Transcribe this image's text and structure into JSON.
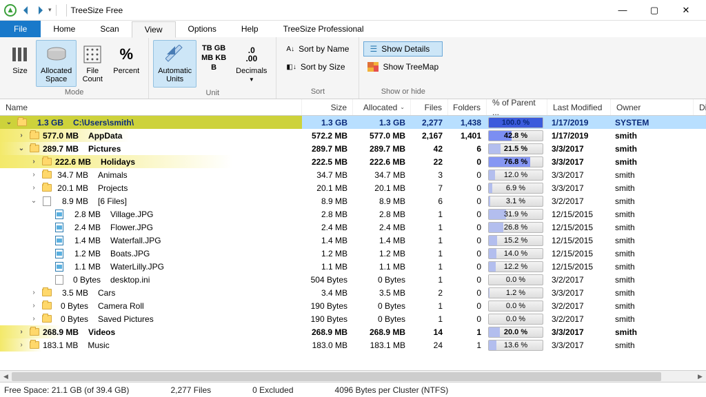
{
  "app": {
    "title": "TreeSize Free"
  },
  "win": {
    "min": "—",
    "max": "▢",
    "close": "✕"
  },
  "tabs": {
    "file": "File",
    "home": "Home",
    "scan": "Scan",
    "view": "View",
    "options": "Options",
    "help": "Help",
    "pro": "TreeSize Professional"
  },
  "ribbon": {
    "mode": {
      "label": "Mode",
      "size": "Size",
      "allocated": "Allocated\nSpace",
      "filecount": "File\nCount",
      "percent": "Percent"
    },
    "unit": {
      "label": "Unit",
      "auto": "Automatic\nUnits",
      "tb": "TB",
      "gb": "GB",
      "mb": "MB",
      "kb": "KB",
      "b": "B",
      "decimals": "Decimals",
      "decimals_val": ".00"
    },
    "sort": {
      "label": "Sort",
      "byname": "Sort by Name",
      "bysize": "Sort by Size"
    },
    "showhide": {
      "label": "Show or hide",
      "details": "Show Details",
      "treemap": "Show TreeMap"
    }
  },
  "columns": {
    "name": "Name",
    "size": "Size",
    "alloc": "Allocated",
    "files": "Files",
    "folders": "Folders",
    "pct": "% of Parent ...",
    "mod": "Last Modified",
    "owner": "Owner",
    "ext": "Di"
  },
  "rows": [
    {
      "indent": 0,
      "exp": "open",
      "icon": "folder",
      "sizetxt": "1.3 GB",
      "name": "C:\\Users\\smith\\",
      "size": "1.3 GB",
      "alloc": "1.3 GB",
      "files": "2,277",
      "folders": "1,438",
      "pct": 100.0,
      "pctlbl": "100.0 %",
      "pcol": "#3b5bdc",
      "mod": "1/17/2019",
      "own": "SYSTEM",
      "bold": true,
      "root": true,
      "grad": 100,
      "gcol": "#cdd23b"
    },
    {
      "indent": 1,
      "exp": "closed",
      "icon": "folder",
      "sizetxt": "577.0 MB",
      "name": "AppData",
      "size": "572.2 MB",
      "alloc": "577.0 MB",
      "files": "2,167",
      "folders": "1,401",
      "pct": 42.8,
      "pctlbl": "42.8 %",
      "pcol": "#7b8ef2",
      "mod": "1/17/2019",
      "own": "smith",
      "bold": true,
      "grad": 43,
      "gcol": "#f3e96a"
    },
    {
      "indent": 1,
      "exp": "open",
      "icon": "folder",
      "sizetxt": "289.7 MB",
      "name": "Pictures",
      "size": "289.7 MB",
      "alloc": "289.7 MB",
      "files": "42",
      "folders": "6",
      "pct": 21.5,
      "pctlbl": "21.5 %",
      "pcol": "#b3beee",
      "mod": "3/3/2017",
      "own": "smith",
      "bold": true,
      "grad": 22,
      "gcol": "#f3e96a"
    },
    {
      "indent": 2,
      "exp": "closed",
      "icon": "folder",
      "sizetxt": "222.6 MB",
      "name": "Holidays",
      "size": "222.5 MB",
      "alloc": "222.6 MB",
      "files": "22",
      "folders": "0",
      "pct": 76.8,
      "pctlbl": "76.8 %",
      "pcol": "#8697f3",
      "mod": "3/3/2017",
      "own": "smith",
      "bold": true,
      "grad": 77,
      "gcol": "#f3e96a"
    },
    {
      "indent": 2,
      "exp": "closed",
      "icon": "folder",
      "sizetxt": "34.7 MB",
      "name": "Animals",
      "size": "34.7 MB",
      "alloc": "34.7 MB",
      "files": "3",
      "folders": "0",
      "pct": 12.0,
      "pctlbl": "12.0 %",
      "pcol": "#b3beee",
      "mod": "3/3/2017",
      "own": "smith"
    },
    {
      "indent": 2,
      "exp": "closed",
      "icon": "folder",
      "sizetxt": "20.1 MB",
      "name": "Projects",
      "size": "20.1 MB",
      "alloc": "20.1 MB",
      "files": "7",
      "folders": "0",
      "pct": 6.9,
      "pctlbl": "6.9 %",
      "pcol": "#b3beee",
      "mod": "3/3/2017",
      "own": "smith"
    },
    {
      "indent": 2,
      "exp": "open",
      "icon": "file",
      "sizetxt": "8.9 MB",
      "name": "[6 Files]",
      "size": "8.9 MB",
      "alloc": "8.9 MB",
      "files": "6",
      "folders": "0",
      "pct": 3.1,
      "pctlbl": "3.1 %",
      "pcol": "#b3beee",
      "mod": "3/2/2017",
      "own": "smith"
    },
    {
      "indent": 3,
      "exp": "none",
      "icon": "jpg",
      "sizetxt": "2.8 MB",
      "name": "Village.JPG",
      "size": "2.8 MB",
      "alloc": "2.8 MB",
      "files": "1",
      "folders": "0",
      "pct": 31.9,
      "pctlbl": "31.9 %",
      "pcol": "#b3beee",
      "mod": "12/15/2015",
      "own": "smith"
    },
    {
      "indent": 3,
      "exp": "none",
      "icon": "jpg",
      "sizetxt": "2.4 MB",
      "name": "Flower.JPG",
      "size": "2.4 MB",
      "alloc": "2.4 MB",
      "files": "1",
      "folders": "0",
      "pct": 26.8,
      "pctlbl": "26.8 %",
      "pcol": "#b3beee",
      "mod": "12/15/2015",
      "own": "smith"
    },
    {
      "indent": 3,
      "exp": "none",
      "icon": "jpg",
      "sizetxt": "1.4 MB",
      "name": "Waterfall.JPG",
      "size": "1.4 MB",
      "alloc": "1.4 MB",
      "files": "1",
      "folders": "0",
      "pct": 15.2,
      "pctlbl": "15.2 %",
      "pcol": "#b3beee",
      "mod": "12/15/2015",
      "own": "smith"
    },
    {
      "indent": 3,
      "exp": "none",
      "icon": "jpg",
      "sizetxt": "1.2 MB",
      "name": "Boats.JPG",
      "size": "1.2 MB",
      "alloc": "1.2 MB",
      "files": "1",
      "folders": "0",
      "pct": 14.0,
      "pctlbl": "14.0 %",
      "pcol": "#b3beee",
      "mod": "12/15/2015",
      "own": "smith"
    },
    {
      "indent": 3,
      "exp": "none",
      "icon": "jpg",
      "sizetxt": "1.1 MB",
      "name": "WaterLilly.JPG",
      "size": "1.1 MB",
      "alloc": "1.1 MB",
      "files": "1",
      "folders": "0",
      "pct": 12.2,
      "pctlbl": "12.2 %",
      "pcol": "#b3beee",
      "mod": "12/15/2015",
      "own": "smith"
    },
    {
      "indent": 3,
      "exp": "none",
      "icon": "file",
      "sizetxt": "0 Bytes",
      "name": "desktop.ini",
      "size": "504 Bytes",
      "alloc": "0 Bytes",
      "files": "1",
      "folders": "0",
      "pct": 0.0,
      "pctlbl": "0.0 %",
      "pcol": "#b3beee",
      "mod": "3/2/2017",
      "own": "smith"
    },
    {
      "indent": 2,
      "exp": "closed",
      "icon": "folder",
      "sizetxt": "3.5 MB",
      "name": "Cars",
      "size": "3.4 MB",
      "alloc": "3.5 MB",
      "files": "2",
      "folders": "0",
      "pct": 1.2,
      "pctlbl": "1.2 %",
      "pcol": "#b3beee",
      "mod": "3/3/2017",
      "own": "smith"
    },
    {
      "indent": 2,
      "exp": "closed",
      "icon": "folder",
      "sizetxt": "0 Bytes",
      "name": "Camera Roll",
      "size": "190 Bytes",
      "alloc": "0 Bytes",
      "files": "1",
      "folders": "0",
      "pct": 0.0,
      "pctlbl": "0.0 %",
      "pcol": "#b3beee",
      "mod": "3/2/2017",
      "own": "smith"
    },
    {
      "indent": 2,
      "exp": "closed",
      "icon": "folder",
      "sizetxt": "0 Bytes",
      "name": "Saved Pictures",
      "size": "190 Bytes",
      "alloc": "0 Bytes",
      "files": "1",
      "folders": "0",
      "pct": 0.0,
      "pctlbl": "0.0 %",
      "pcol": "#b3beee",
      "mod": "3/2/2017",
      "own": "smith"
    },
    {
      "indent": 1,
      "exp": "closed",
      "icon": "folder",
      "sizetxt": "268.9 MB",
      "name": "Videos",
      "size": "268.9 MB",
      "alloc": "268.9 MB",
      "files": "14",
      "folders": "1",
      "pct": 20.0,
      "pctlbl": "20.0 %",
      "pcol": "#b3beee",
      "mod": "3/3/2017",
      "own": "smith",
      "bold": true,
      "grad": 20,
      "gcol": "#f3e96a"
    },
    {
      "indent": 1,
      "exp": "closed",
      "icon": "folder",
      "sizetxt": "183.1 MB",
      "name": "Music",
      "size": "183.0 MB",
      "alloc": "183.1 MB",
      "files": "24",
      "folders": "1",
      "pct": 13.6,
      "pctlbl": "13.6 %",
      "pcol": "#b3beee",
      "mod": "3/3/2017",
      "own": "smith",
      "grad": 14,
      "gcol": "#f3e96a"
    }
  ],
  "status": {
    "free": "Free Space: 21.1 GB  (of 39.4 GB)",
    "files": "2,277 Files",
    "excluded": "0 Excluded",
    "cluster": "4096  Bytes per Cluster (NTFS)"
  }
}
